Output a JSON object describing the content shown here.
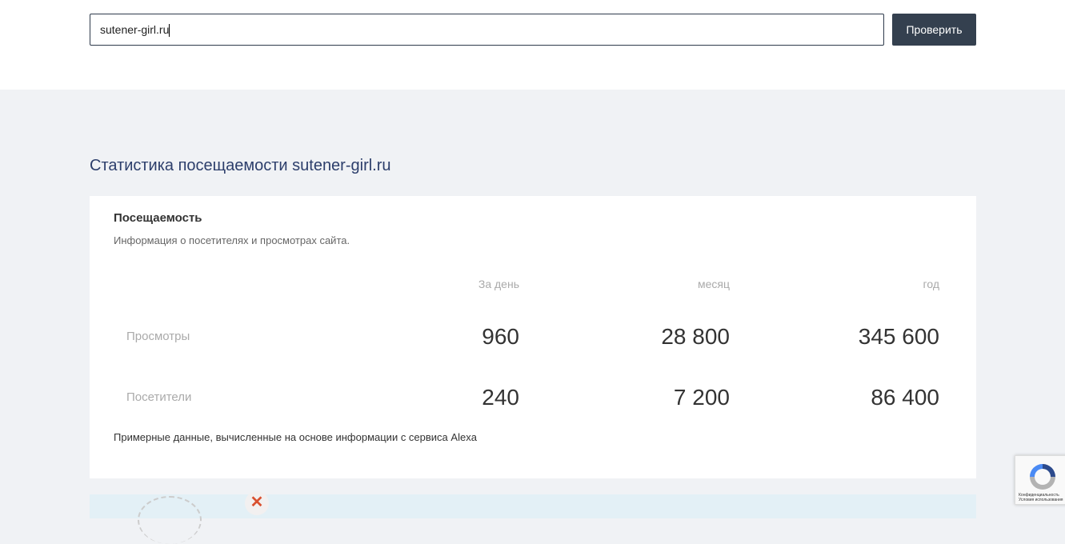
{
  "search": {
    "value": "sutener-girl.ru",
    "button": "Проверить"
  },
  "section_title": "Статистика посещаемости sutener-girl.ru",
  "card": {
    "title": "Посещаемость",
    "subtitle": "Информация о посетителях и просмотрах сайта.",
    "columns": [
      "За день",
      "месяц",
      "год"
    ],
    "rows": [
      {
        "label": "Просмотры",
        "values": [
          "960",
          "28 800",
          "345 600"
        ]
      },
      {
        "label": "Посетители",
        "values": [
          "240",
          "7 200",
          "86 400"
        ]
      }
    ],
    "note": "Примерные данные, вычисленные на основе информации с сервиса Alexa"
  },
  "recaptcha": {
    "privacy": "Конфиденциальность",
    "terms": "Условия использования"
  }
}
